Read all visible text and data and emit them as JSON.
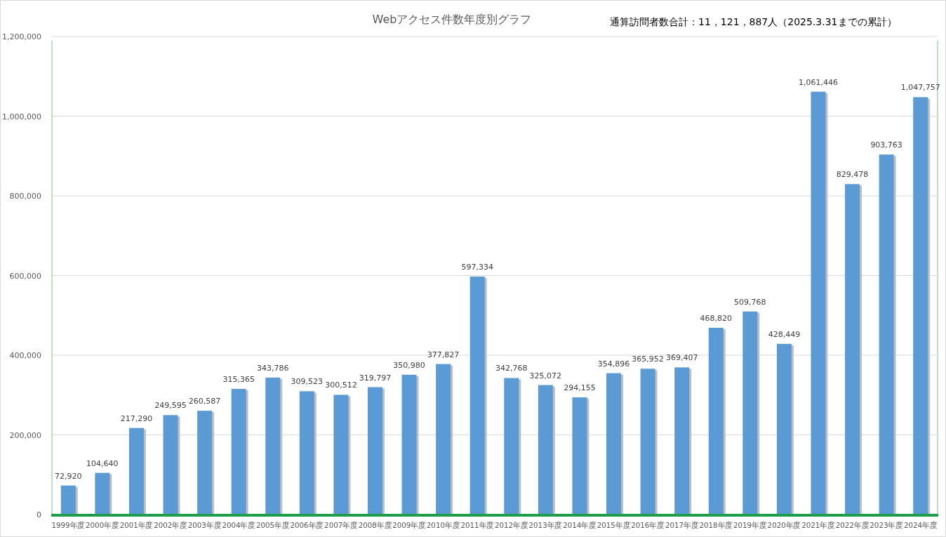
{
  "summary": "通算訪問者数合計：11，121，887人（2025.3.31までの累計）",
  "chart_data": {
    "type": "bar",
    "title": "Webアクセス件数年度別グラフ",
    "categories": [
      "1999年度",
      "2000年度",
      "2001年度",
      "2002年度",
      "2003年度",
      "2004年度",
      "2005年度",
      "2006年度",
      "2007年度",
      "2008年度",
      "2009年度",
      "2010年度",
      "2011年度",
      "2012年度",
      "2013年度",
      "2014年度",
      "2015年度",
      "2016年度",
      "2017年度",
      "2018年度",
      "2019年度",
      "2020年度",
      "2021年度",
      "2022年度",
      "2023年度",
      "2024年度"
    ],
    "series": [
      {
        "color": "#5b9bd5",
        "values": [
          72920,
          104640,
          217290,
          249595,
          260587,
          315365,
          343786,
          309523,
          300512,
          319797,
          350980,
          377827,
          597334,
          342768,
          325072,
          294155,
          354896,
          365952,
          369407,
          468820,
          509768,
          428449,
          1061446,
          829478,
          903763,
          1047757
        ]
      }
    ],
    "ylim": [
      0,
      1200000
    ],
    "yticks": [
      {
        "value": 0,
        "label": "0"
      },
      {
        "value": 200000,
        "label": "200,000"
      },
      {
        "value": 400000,
        "label": "400,000"
      },
      {
        "value": 600000,
        "label": "600,000"
      },
      {
        "value": 800000,
        "label": "800,000"
      },
      {
        "value": 1000000,
        "label": "1,000,000"
      },
      {
        "value": 1200000,
        "label": "1,200,000"
      }
    ],
    "grid": true,
    "value_labels": [
      "72,920",
      "104,640",
      "217,290",
      "249,595",
      "260,587",
      "315,365",
      "343,786",
      "309,523",
      "300,512",
      "319,797",
      "350,980",
      "377,827",
      "597,334",
      "342,768",
      "325,072",
      "294,155",
      "354,896",
      "365,952",
      "369,407",
      "468,820",
      "509,768",
      "428,449",
      "1,061,446",
      "829,478",
      "903,763",
      "1,047,757"
    ]
  }
}
